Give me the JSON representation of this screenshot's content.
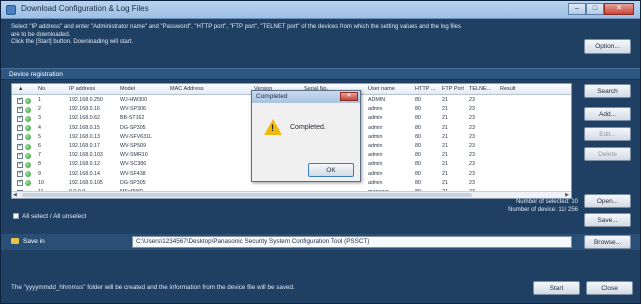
{
  "window": {
    "title": "Download Configuration & Log Files"
  },
  "instructions": {
    "line1": "Select \"IP address\" and enter \"Administrator name\" and \"Password\", \"HTTP port\", \"FTP port\", \"TELNET port\" of the devices from which the setting values and the log files",
    "line2": "are to be downloaded.",
    "line3": "Click the [Start] button. Downloading will start."
  },
  "option_button": "Option...",
  "device_registration": {
    "label": "Device registration"
  },
  "table": {
    "headers": [
      "No.",
      "IP address",
      "Model",
      "MAC Address",
      "Version",
      "Serial No.",
      "User name",
      "HTTP ...",
      "FTP Port",
      "TELNE...",
      "Result"
    ],
    "rows": [
      {
        "no": "1",
        "checked": true,
        "status": true,
        "ip": "192.168.0.250",
        "model": "WJ-HW300",
        "mac": "",
        "version": "",
        "serial": "",
        "user": "ADMIN",
        "http": "80",
        "ftp": "21",
        "telnet": "23"
      },
      {
        "no": "2",
        "checked": true,
        "status": true,
        "ip": "192.168.0.16",
        "model": "WV-SP306",
        "mac": "",
        "version": "",
        "serial": "",
        "user": "admin",
        "http": "80",
        "ftp": "21",
        "telnet": "23"
      },
      {
        "no": "3",
        "checked": true,
        "status": true,
        "ip": "192.168.0.62",
        "model": "BB-ST162",
        "mac": "",
        "version": "",
        "serial": "",
        "user": "admin",
        "http": "80",
        "ftp": "21",
        "telnet": "23"
      },
      {
        "no": "4",
        "checked": true,
        "status": true,
        "ip": "192.168.0.15",
        "model": "DG-SP305",
        "mac": "",
        "version": "",
        "serial": "",
        "user": "admin",
        "http": "80",
        "ftp": "21",
        "telnet": "23"
      },
      {
        "no": "5",
        "checked": true,
        "status": true,
        "ip": "192.168.0.13",
        "model": "WV-SFV631L",
        "mac": "",
        "version": "",
        "serial": "",
        "user": "admin",
        "http": "80",
        "ftp": "21",
        "telnet": "23"
      },
      {
        "no": "6",
        "checked": true,
        "status": true,
        "ip": "192.168.0.17",
        "model": "WV-SP509",
        "mac": "",
        "version": "",
        "serial": "",
        "user": "admin",
        "http": "80",
        "ftp": "21",
        "telnet": "23"
      },
      {
        "no": "7",
        "checked": true,
        "status": true,
        "ip": "192.168.0.103",
        "model": "WV-SMR10",
        "mac": "",
        "version": "",
        "serial": "",
        "user": "admin",
        "http": "80",
        "ftp": "21",
        "telnet": "23"
      },
      {
        "no": "8",
        "checked": true,
        "status": true,
        "ip": "192.168.0.12",
        "model": "WV-SC386",
        "mac": "",
        "version": "",
        "serial": "",
        "user": "admin",
        "http": "80",
        "ftp": "21",
        "telnet": "23"
      },
      {
        "no": "9",
        "checked": true,
        "status": true,
        "ip": "192.168.0.14",
        "model": "WV-SF438",
        "mac": "",
        "version": "",
        "serial": "",
        "user": "admin",
        "http": "80",
        "ftp": "21",
        "telnet": "23"
      },
      {
        "no": "10",
        "checked": true,
        "status": true,
        "ip": "192.168.0.105",
        "model": "DG-SP305",
        "mac": "",
        "version": "",
        "serial": "",
        "user": "admin",
        "http": "80",
        "ftp": "21",
        "telnet": "23"
      },
      {
        "no": "11",
        "checked": false,
        "status": false,
        "ip": "0.0.0.0",
        "model": "MSePWR",
        "mac": "",
        "version": "",
        "serial": "",
        "user": "manager",
        "http": "80",
        "ftp": "21",
        "telnet": "23"
      }
    ]
  },
  "side_buttons": {
    "search": "Search",
    "add": "Add...",
    "edit": "Edit...",
    "delete": "Delete",
    "open": "Open...",
    "save": "Save..."
  },
  "dialog": {
    "title": "Completed",
    "message": "Completed.",
    "ok": "OK"
  },
  "select_all": "All select / All unselect",
  "counts": {
    "selected": "Number of selected: 10",
    "devices": "Number of device:  11/ 256"
  },
  "save_in": {
    "label": "Save in",
    "path": "C:\\Users\\1234567\\Desktop\\Panasonic Security System Configuration Tool (PSSCT)",
    "browse": "Browse..."
  },
  "footer": {
    "note": "The \"yyyymmdd_hhmmss\" folder will be created and the information from the device file will be saved.",
    "start": "Start",
    "close": "Close"
  }
}
